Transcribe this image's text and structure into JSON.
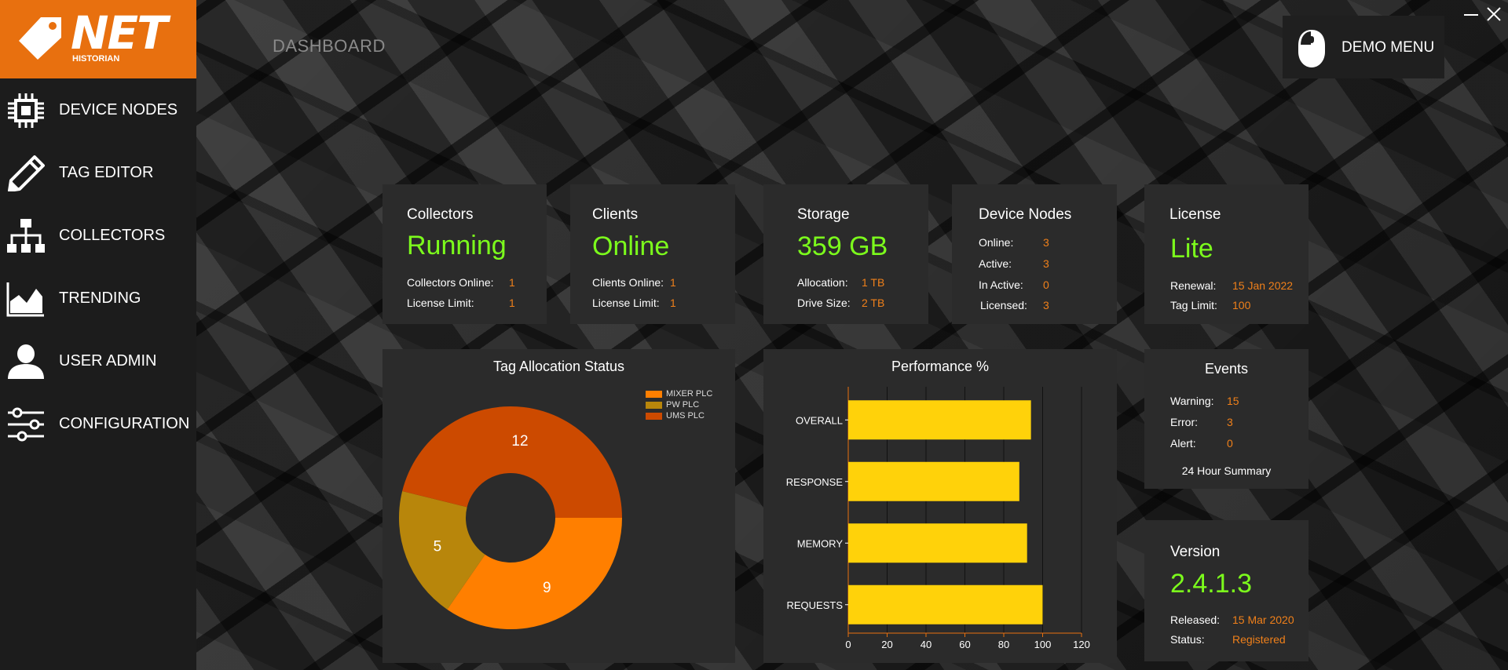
{
  "app": {
    "logo_text": "NET",
    "logo_subtext": "HISTORIAN",
    "page_title": "DASHBOARD",
    "accent": "#e8700f",
    "green": "#7CFC1C",
    "value_orange": "#f0801a"
  },
  "sidebar": {
    "items": [
      {
        "label": "DEVICE NODES",
        "icon": "chip-icon"
      },
      {
        "label": "TAG EDITOR",
        "icon": "pencil-icon"
      },
      {
        "label": "COLLECTORS",
        "icon": "network-icon"
      },
      {
        "label": "TRENDING",
        "icon": "chart-icon"
      },
      {
        "label": "USER ADMIN",
        "icon": "user-icon"
      },
      {
        "label": "CONFIGURATION",
        "icon": "sliders-icon"
      }
    ]
  },
  "header": {
    "demo_menu_label": "DEMO MENU"
  },
  "cards": {
    "collectors": {
      "title": "Collectors",
      "status": "Running",
      "rows": [
        {
          "label": "Collectors Online:",
          "value": "1"
        },
        {
          "label": "License Limit:",
          "value": "1"
        }
      ]
    },
    "clients": {
      "title": "Clients",
      "status": "Online",
      "rows": [
        {
          "label": "Clients Online:",
          "value": "1"
        },
        {
          "label": "License Limit:",
          "value": "1"
        }
      ]
    },
    "storage": {
      "title": "Storage",
      "status": "359 GB",
      "rows": [
        {
          "label": "Allocation:",
          "value": "1 TB"
        },
        {
          "label": "Drive Size:",
          "value": "2 TB"
        }
      ]
    },
    "device_nodes": {
      "title": "Device Nodes",
      "rows": [
        {
          "label": "Online:",
          "value": "3"
        },
        {
          "label": "Active:",
          "value": "3"
        },
        {
          "label": "In Active:",
          "value": "0"
        },
        {
          "label": "Licensed:",
          "value": "3"
        }
      ]
    },
    "license": {
      "title": "License",
      "status": "Lite",
      "rows": [
        {
          "label": "Renewal:",
          "value": "15 Jan 2022"
        },
        {
          "label": "Tag Limit:",
          "value": "100"
        }
      ]
    },
    "events": {
      "title": "Events",
      "rows": [
        {
          "label": "Warning:",
          "value": "15"
        },
        {
          "label": "Error:",
          "value": "3"
        },
        {
          "label": "Alert:",
          "value": "0"
        }
      ],
      "footer": "24 Hour Summary"
    },
    "version": {
      "title": "Version",
      "status": "2.4.1.3",
      "rows": [
        {
          "label": "Released:",
          "value": "15 Mar 2020"
        },
        {
          "label": "Status:",
          "value": "Registered"
        }
      ]
    }
  },
  "chart_data": [
    {
      "type": "pie",
      "title": "Tag Allocation Status",
      "donut": true,
      "legend_position": "top-right",
      "slices": [
        {
          "name": "MIXER PLC",
          "value": 9,
          "color": "#ff7f00"
        },
        {
          "name": "PW PLC",
          "value": 5,
          "color": "#b8860b"
        },
        {
          "name": "UMS PLC",
          "value": 12,
          "color": "#cc4a00"
        }
      ]
    },
    {
      "type": "bar",
      "orientation": "horizontal",
      "title": "Performance %",
      "categories": [
        "OVERALL",
        "RESPONSE",
        "MEMORY",
        "REQUESTS"
      ],
      "values": [
        94,
        88,
        92,
        100
      ],
      "xlim": [
        0,
        120
      ],
      "xticks": [
        0,
        20,
        40,
        60,
        80,
        100,
        120
      ],
      "grid": true,
      "bar_color": "#ffd20a",
      "axis_color": "#e8700f"
    }
  ]
}
